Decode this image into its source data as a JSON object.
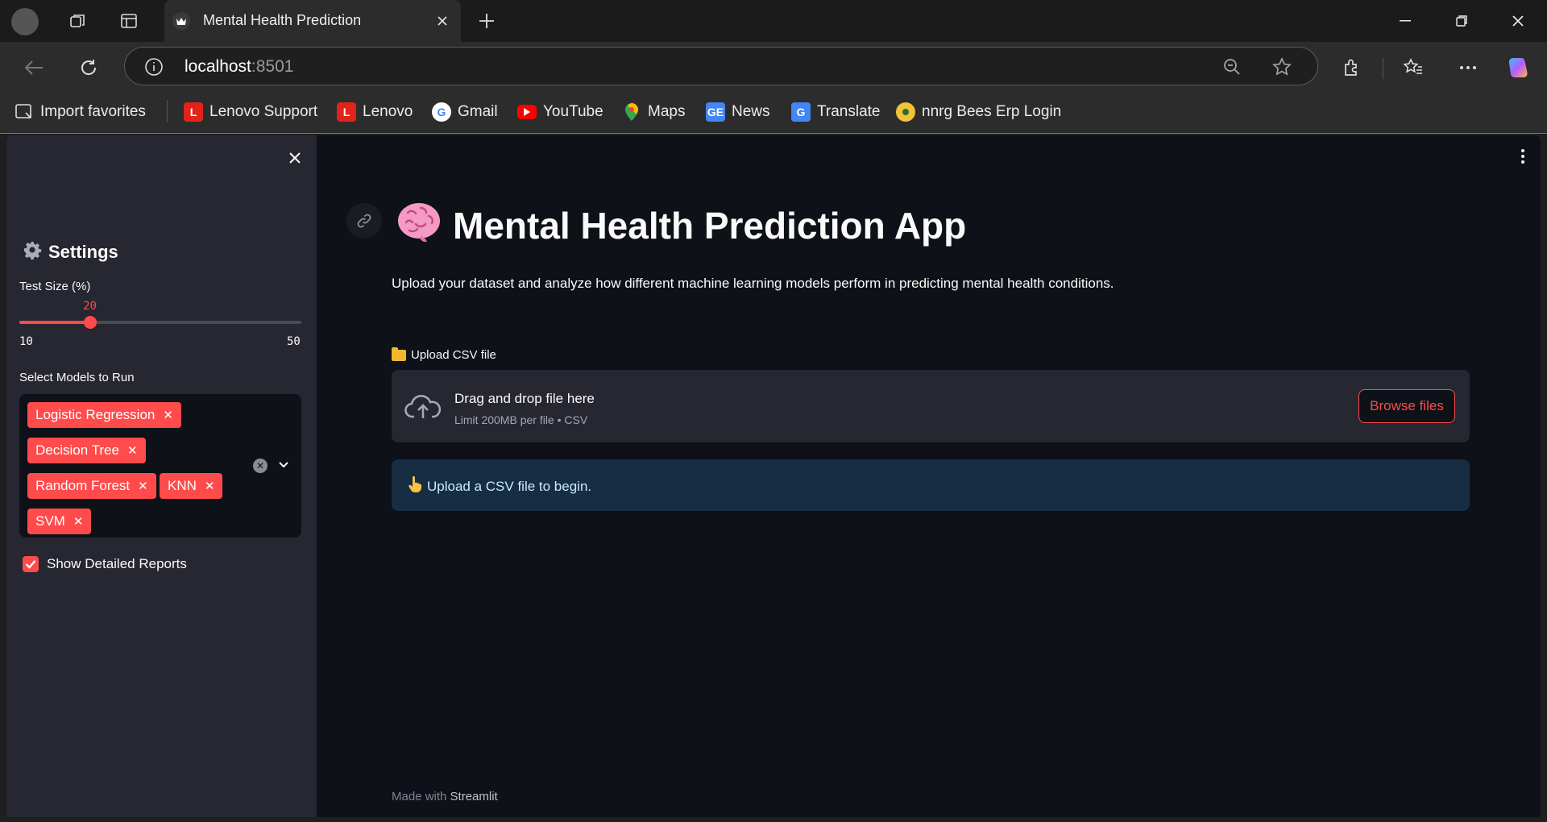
{
  "browser": {
    "tab_title": "Mental Health Prediction",
    "url_host": "localhost",
    "url_port": ":8501"
  },
  "bookmarks": [
    {
      "label": "Import favorites",
      "icon": "import-icon"
    },
    {
      "label": "Lenovo Support",
      "icon": "lenovo-icon",
      "color": "#e2231a"
    },
    {
      "label": "Lenovo",
      "icon": "lenovo-icon",
      "color": "#e2231a"
    },
    {
      "label": "Gmail",
      "icon": "google-icon"
    },
    {
      "label": "YouTube",
      "icon": "youtube-icon",
      "color": "#ff0000"
    },
    {
      "label": "Maps",
      "icon": "maps-icon"
    },
    {
      "label": "News",
      "icon": "news-icon",
      "color": "#4285f4"
    },
    {
      "label": "Translate",
      "icon": "translate-icon",
      "color": "#4285f4"
    },
    {
      "label": "nnrg Bees Erp Login",
      "icon": "bee-icon"
    }
  ],
  "sidebar": {
    "title": "Settings",
    "slider": {
      "label": "Test Size (%)",
      "value": 20,
      "value_label": "20",
      "min": 10,
      "max": 50,
      "min_label": "10",
      "max_label": "50"
    },
    "models": {
      "label": "Select Models to Run",
      "selected": [
        "Logistic Regression",
        "Decision Tree",
        "Random Forest",
        "KNN",
        "SVM"
      ]
    },
    "checkbox": {
      "label": "Show Detailed Reports",
      "checked": true
    }
  },
  "main": {
    "title": "Mental Health Prediction App",
    "description": "Upload your dataset and analyze how different machine learning models perform in predicting mental health conditions.",
    "uploader": {
      "label": "Upload CSV file",
      "drag_text": "Drag and drop file here",
      "limit_text": "Limit 200MB per file • CSV",
      "button_label": "Browse files"
    },
    "info_text": "Upload a CSV file to begin.",
    "footer_prefix": "Made with ",
    "footer_brand": "Streamlit"
  },
  "colors": {
    "accent": "#ff4b4b",
    "app_bg": "#0e1117",
    "sidebar_bg": "#262730",
    "info_bg": "#172d43"
  }
}
